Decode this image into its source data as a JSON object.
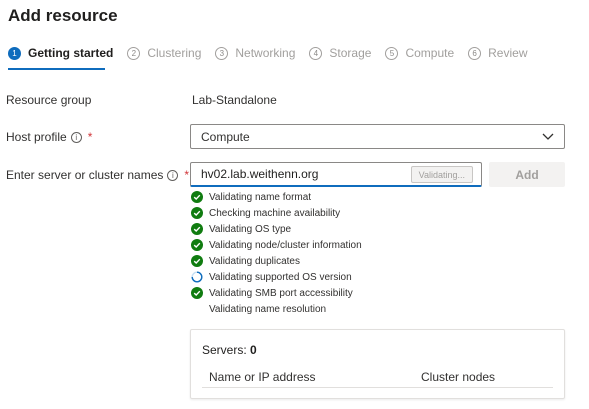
{
  "page": {
    "title": "Add resource"
  },
  "steps": [
    {
      "num": "1",
      "label": "Getting started"
    },
    {
      "num": "2",
      "label": "Clustering"
    },
    {
      "num": "3",
      "label": "Networking"
    },
    {
      "num": "4",
      "label": "Storage"
    },
    {
      "num": "5",
      "label": "Compute"
    },
    {
      "num": "6",
      "label": "Review"
    }
  ],
  "active_step": 0,
  "form": {
    "resource_group": {
      "label": "Resource group",
      "value": "Lab-Standalone"
    },
    "host_profile": {
      "label": "Host profile",
      "value": "Compute",
      "required_mark": "*"
    },
    "server_names": {
      "label": "Enter server or cluster names",
      "value": "hv02.lab.weithenn.org",
      "status_pill": "Validating...",
      "required_mark": "*",
      "add_label": "Add"
    }
  },
  "validation": [
    {
      "label": "Validating name format",
      "status": "success"
    },
    {
      "label": "Checking machine availability",
      "status": "success"
    },
    {
      "label": "Validating OS type",
      "status": "success"
    },
    {
      "label": "Validating node/cluster information",
      "status": "success"
    },
    {
      "label": "Validating duplicates",
      "status": "success"
    },
    {
      "label": "Validating supported OS version",
      "status": "in-progress"
    },
    {
      "label": "Validating SMB port accessibility",
      "status": "success"
    },
    {
      "label": "Validating name resolution",
      "status": "pending"
    }
  ],
  "servers": {
    "title": "Servers:",
    "count": "0",
    "columns": [
      "Name or IP address",
      "Cluster nodes"
    ]
  },
  "icons": {
    "info": "info-icon",
    "success": "check-circle-icon",
    "progress": "spinner-icon",
    "dropdown": "chevron-down-icon"
  },
  "colors": {
    "accent": "#0f6cbd",
    "success": "#107c10",
    "required": "#d13438"
  }
}
